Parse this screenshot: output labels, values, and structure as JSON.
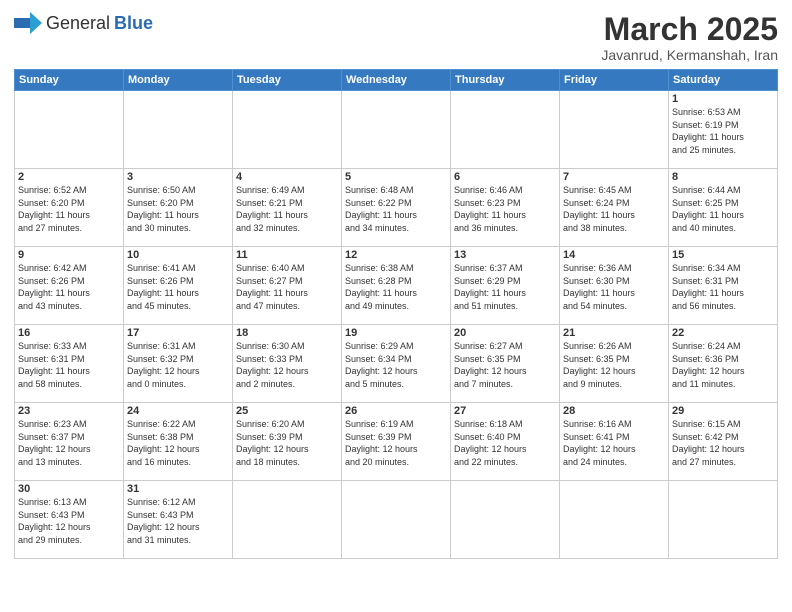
{
  "logo": {
    "general": "General",
    "blue": "Blue"
  },
  "header": {
    "month": "March 2025",
    "location": "Javanrud, Kermanshah, Iran"
  },
  "weekdays": [
    "Sunday",
    "Monday",
    "Tuesday",
    "Wednesday",
    "Thursday",
    "Friday",
    "Saturday"
  ],
  "weeks": [
    [
      {
        "day": "",
        "info": ""
      },
      {
        "day": "",
        "info": ""
      },
      {
        "day": "",
        "info": ""
      },
      {
        "day": "",
        "info": ""
      },
      {
        "day": "",
        "info": ""
      },
      {
        "day": "",
        "info": ""
      },
      {
        "day": "1",
        "info": "Sunrise: 6:53 AM\nSunset: 6:19 PM\nDaylight: 11 hours\nand 25 minutes."
      }
    ],
    [
      {
        "day": "2",
        "info": "Sunrise: 6:52 AM\nSunset: 6:20 PM\nDaylight: 11 hours\nand 27 minutes."
      },
      {
        "day": "3",
        "info": "Sunrise: 6:50 AM\nSunset: 6:20 PM\nDaylight: 11 hours\nand 30 minutes."
      },
      {
        "day": "4",
        "info": "Sunrise: 6:49 AM\nSunset: 6:21 PM\nDaylight: 11 hours\nand 32 minutes."
      },
      {
        "day": "5",
        "info": "Sunrise: 6:48 AM\nSunset: 6:22 PM\nDaylight: 11 hours\nand 34 minutes."
      },
      {
        "day": "6",
        "info": "Sunrise: 6:46 AM\nSunset: 6:23 PM\nDaylight: 11 hours\nand 36 minutes."
      },
      {
        "day": "7",
        "info": "Sunrise: 6:45 AM\nSunset: 6:24 PM\nDaylight: 11 hours\nand 38 minutes."
      },
      {
        "day": "8",
        "info": "Sunrise: 6:44 AM\nSunset: 6:25 PM\nDaylight: 11 hours\nand 40 minutes."
      }
    ],
    [
      {
        "day": "9",
        "info": "Sunrise: 6:42 AM\nSunset: 6:26 PM\nDaylight: 11 hours\nand 43 minutes."
      },
      {
        "day": "10",
        "info": "Sunrise: 6:41 AM\nSunset: 6:26 PM\nDaylight: 11 hours\nand 45 minutes."
      },
      {
        "day": "11",
        "info": "Sunrise: 6:40 AM\nSunset: 6:27 PM\nDaylight: 11 hours\nand 47 minutes."
      },
      {
        "day": "12",
        "info": "Sunrise: 6:38 AM\nSunset: 6:28 PM\nDaylight: 11 hours\nand 49 minutes."
      },
      {
        "day": "13",
        "info": "Sunrise: 6:37 AM\nSunset: 6:29 PM\nDaylight: 11 hours\nand 51 minutes."
      },
      {
        "day": "14",
        "info": "Sunrise: 6:36 AM\nSunset: 6:30 PM\nDaylight: 11 hours\nand 54 minutes."
      },
      {
        "day": "15",
        "info": "Sunrise: 6:34 AM\nSunset: 6:31 PM\nDaylight: 11 hours\nand 56 minutes."
      }
    ],
    [
      {
        "day": "16",
        "info": "Sunrise: 6:33 AM\nSunset: 6:31 PM\nDaylight: 11 hours\nand 58 minutes."
      },
      {
        "day": "17",
        "info": "Sunrise: 6:31 AM\nSunset: 6:32 PM\nDaylight: 12 hours\nand 0 minutes."
      },
      {
        "day": "18",
        "info": "Sunrise: 6:30 AM\nSunset: 6:33 PM\nDaylight: 12 hours\nand 2 minutes."
      },
      {
        "day": "19",
        "info": "Sunrise: 6:29 AM\nSunset: 6:34 PM\nDaylight: 12 hours\nand 5 minutes."
      },
      {
        "day": "20",
        "info": "Sunrise: 6:27 AM\nSunset: 6:35 PM\nDaylight: 12 hours\nand 7 minutes."
      },
      {
        "day": "21",
        "info": "Sunrise: 6:26 AM\nSunset: 6:35 PM\nDaylight: 12 hours\nand 9 minutes."
      },
      {
        "day": "22",
        "info": "Sunrise: 6:24 AM\nSunset: 6:36 PM\nDaylight: 12 hours\nand 11 minutes."
      }
    ],
    [
      {
        "day": "23",
        "info": "Sunrise: 6:23 AM\nSunset: 6:37 PM\nDaylight: 12 hours\nand 13 minutes."
      },
      {
        "day": "24",
        "info": "Sunrise: 6:22 AM\nSunset: 6:38 PM\nDaylight: 12 hours\nand 16 minutes."
      },
      {
        "day": "25",
        "info": "Sunrise: 6:20 AM\nSunset: 6:39 PM\nDaylight: 12 hours\nand 18 minutes."
      },
      {
        "day": "26",
        "info": "Sunrise: 6:19 AM\nSunset: 6:39 PM\nDaylight: 12 hours\nand 20 minutes."
      },
      {
        "day": "27",
        "info": "Sunrise: 6:18 AM\nSunset: 6:40 PM\nDaylight: 12 hours\nand 22 minutes."
      },
      {
        "day": "28",
        "info": "Sunrise: 6:16 AM\nSunset: 6:41 PM\nDaylight: 12 hours\nand 24 minutes."
      },
      {
        "day": "29",
        "info": "Sunrise: 6:15 AM\nSunset: 6:42 PM\nDaylight: 12 hours\nand 27 minutes."
      }
    ],
    [
      {
        "day": "30",
        "info": "Sunrise: 6:13 AM\nSunset: 6:43 PM\nDaylight: 12 hours\nand 29 minutes."
      },
      {
        "day": "31",
        "info": "Sunrise: 6:12 AM\nSunset: 6:43 PM\nDaylight: 12 hours\nand 31 minutes."
      },
      {
        "day": "",
        "info": ""
      },
      {
        "day": "",
        "info": ""
      },
      {
        "day": "",
        "info": ""
      },
      {
        "day": "",
        "info": ""
      },
      {
        "day": "",
        "info": ""
      }
    ]
  ]
}
